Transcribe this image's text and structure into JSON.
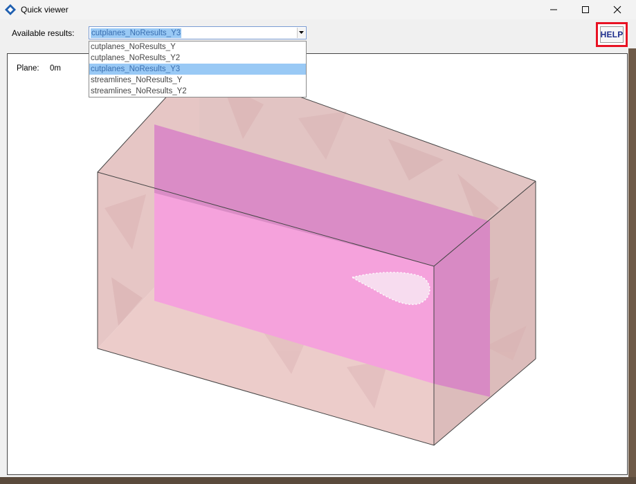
{
  "window": {
    "title": "Quick viewer",
    "app_icon": "diamond-app-icon",
    "controls": {
      "minimize_icon": "minimize-icon",
      "maximize_icon": "maximize-icon",
      "close_icon": "close-icon"
    }
  },
  "toolbar": {
    "results_label": "Available results:",
    "selected_result": "cutplanes_NoResults_Y3",
    "dropdown_icon": "chevron-down-icon",
    "options": [
      "cutplanes_NoResults_Y",
      "cutplanes_NoResults_Y2",
      "cutplanes_NoResults_Y3",
      "streamlines_NoResults_Y",
      "streamlines_NoResults_Y2"
    ],
    "selected_index": 2,
    "help_label": "HELP"
  },
  "viewer": {
    "plane_label": "Plane:",
    "plane_value": "0m"
  },
  "colors": {
    "selection": "#99c9f5",
    "help_highlight": "#e81123",
    "domain_box": "#e8c6c4",
    "cut_plane": "#f5a3dc",
    "cut_plane_behind": "#d98cc6"
  }
}
